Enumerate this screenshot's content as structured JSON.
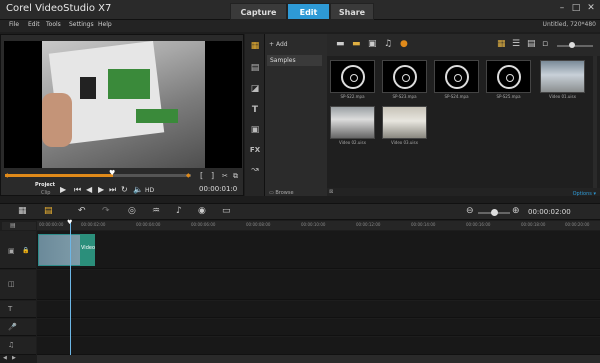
{
  "app": {
    "title": "Corel VideoStudio X7",
    "project_info": "Untitled, 720*480"
  },
  "step_tabs": [
    "Capture",
    "Edit",
    "Share"
  ],
  "menu": [
    "File",
    "Edit",
    "Tools",
    "Settings",
    "Help"
  ],
  "player": {
    "mode_project": "Project",
    "mode_clip": "Clip",
    "timecode": "00:00:01:0",
    "hd_label": "HD"
  },
  "library": {
    "add_label": "Add",
    "folder": "Samples",
    "browse_label": "Browse",
    "options_label": "Options",
    "items": [
      {
        "label": "SP-S22.mpa",
        "kind": "audio"
      },
      {
        "label": "SP-S23.mpa",
        "kind": "audio"
      },
      {
        "label": "SP-S24.mpa",
        "kind": "audio"
      },
      {
        "label": "SP-S25.mpa",
        "kind": "audio"
      },
      {
        "label": "Video 01.uisx",
        "kind": "video"
      },
      {
        "label": "Video 02.uisx",
        "kind": "video"
      },
      {
        "label": "Video 03.uisx",
        "kind": "video"
      }
    ]
  },
  "timeline": {
    "timecode": "00:00:02:00",
    "ruler": [
      "00:00:00:00",
      "00:00:02:00",
      "00:00:04:00",
      "00:00:06:00",
      "00:00:08:00",
      "00:00:10:00",
      "00:00:12:00",
      "00:00:14:00",
      "00:00:16:00",
      "00:00:18:00",
      "00:00:20:00"
    ],
    "clip_label": "Video"
  },
  "colors": {
    "accent": "#2e9ad6",
    "scrub": "#e08a1a",
    "clip": "#2b8f7b"
  }
}
